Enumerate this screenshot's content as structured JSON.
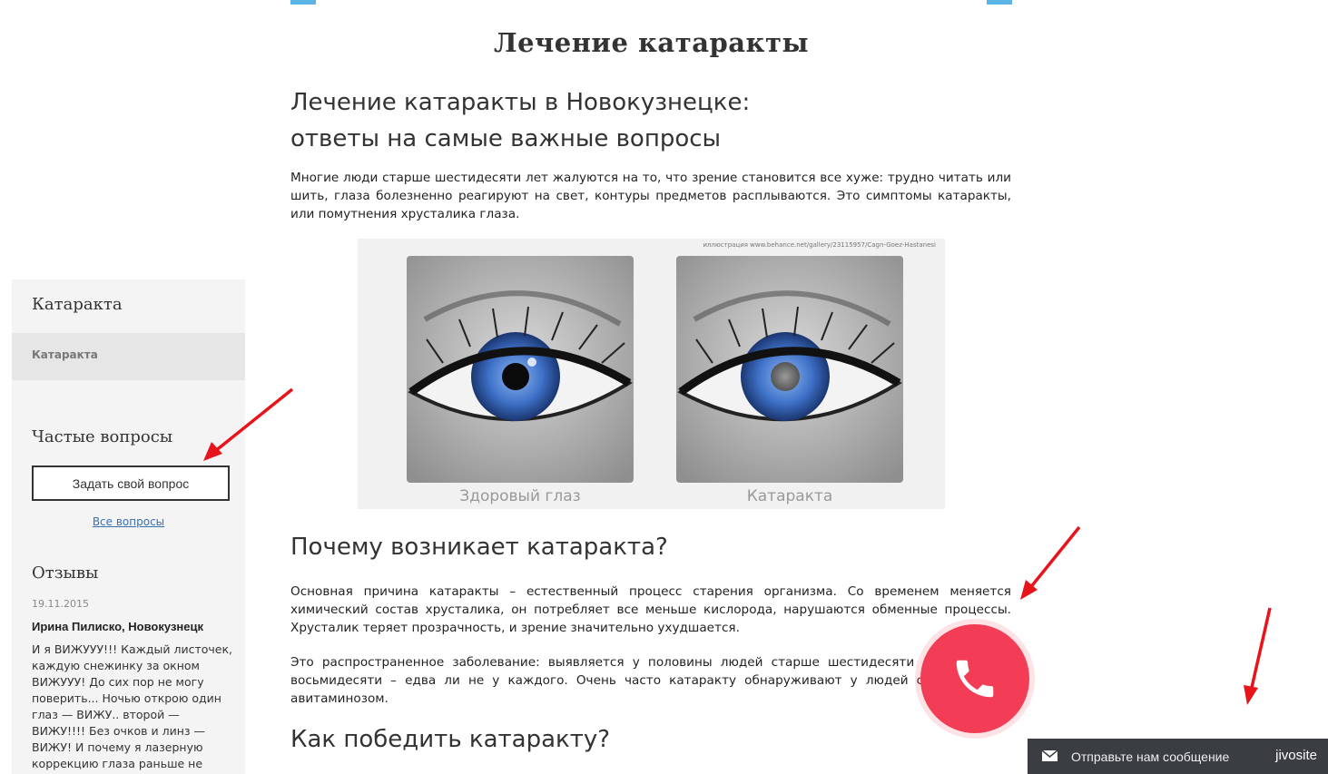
{
  "page": {
    "title": "Лечение катаракты",
    "heading_line1": "Лечение катаракты в Новокузнецке:",
    "heading_line2": "ответы на самые важные вопросы",
    "intro": "Многие люди старше шестидесяти лет жалуются на то, что зрение становится все хуже: трудно читать или шить, глаза болезненно реагируют на свет, контуры предметов расплываются. Это симптомы катаракты, или помутнения хрусталика глаза.",
    "figure": {
      "credit": "иллюстрация www.behance.net/gallery/23115957/Cagn-Goez-Hastanesi",
      "healthy_caption": "Здоровый глаз",
      "cataract_caption": "Катаракта"
    },
    "section1_title": "Почему возникает катаракта?",
    "section1_p1": "Основная причина катаракты – естественный процесс старения организма. Со временем меняется химический состав хрусталика, он потребляет все меньше кислорода, нарушаются обменные процессы. Хрусталик теряет прозрачность, и зрение значительно ухудшается.",
    "section1_p2": "Это распространенное заболевание: выявляется у половины людей старше шестидесяти лет, а после восьмидесяти – едва ли не у каждого. Очень часто катаракту обнаруживают у людей с диабетом и авитаминозом.",
    "section2_title": "Как победить катаракту?"
  },
  "sidebar": {
    "title": "Катаракта",
    "active_item": "Катаракта",
    "faq_title": "Частые вопросы",
    "ask_button": "Задать свой вопрос",
    "all_questions": "Все вопросы",
    "reviews_title": "Отзывы",
    "review": {
      "date": "19.11.2015",
      "author": "Ирина Пилиско, Новокузнецк",
      "text": "И я ВИЖУУУ!!! Каждый листочек, каждую снежинку за окном ВИЖУУУ! До сих пор не могу поверить... Ночью открою один глаз — ВИЖУ.. второй — ВИЖУ!!!! Без очков и линз — ВИЖУ! И почему я лазерную коррекцию глаза раньше не сделала?! Столько"
    }
  },
  "widgets": {
    "call_icon": "phone-icon",
    "chat_message": "Отправьте нам сообщение",
    "chat_brand": "jivosite",
    "chat_icon": "mail-icon"
  },
  "colors": {
    "accent_blue": "#5ab4e5",
    "call_red": "#f33c55",
    "chat_bg": "#3a3d42",
    "annotation_arrow": "#e8141b"
  }
}
